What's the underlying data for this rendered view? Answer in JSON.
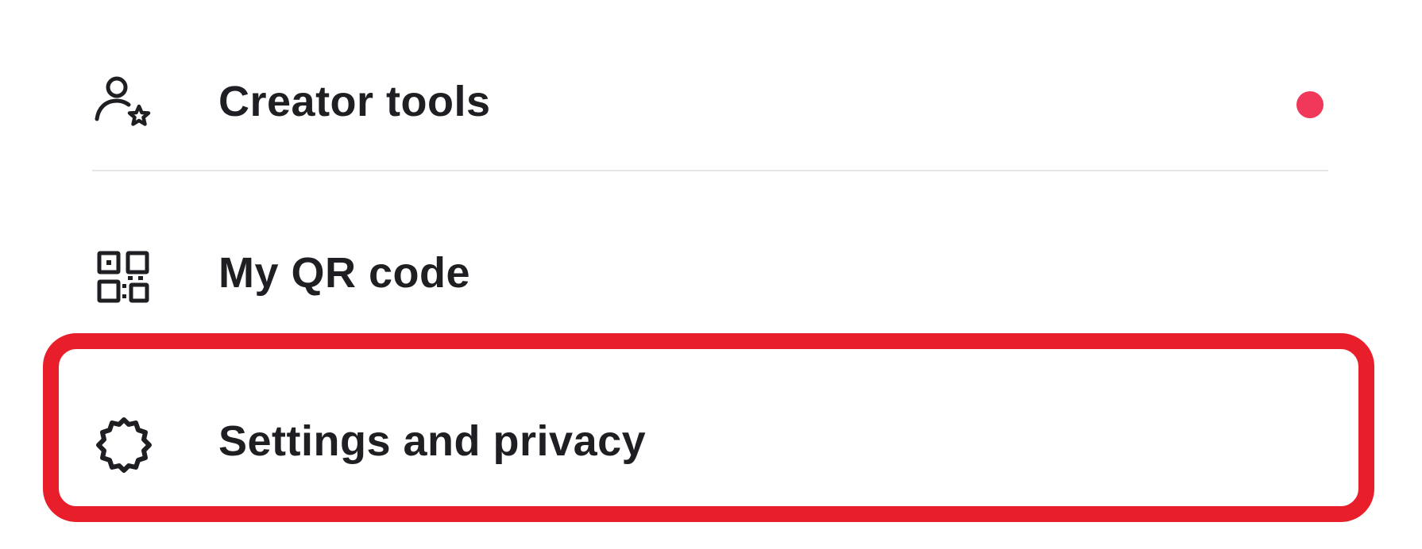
{
  "menu": {
    "items": [
      {
        "label": "Creator tools",
        "icon": "person-star-icon",
        "has_notification": true
      },
      {
        "label": "My QR code",
        "icon": "qr-code-icon"
      },
      {
        "label": "Settings and privacy",
        "icon": "gear-icon",
        "highlighted": true
      }
    ]
  },
  "colors": {
    "notification_dot": "#f2385a",
    "highlight_border": "#e81e2b",
    "text": "#1f1f23",
    "divider": "#e6e6e8"
  }
}
